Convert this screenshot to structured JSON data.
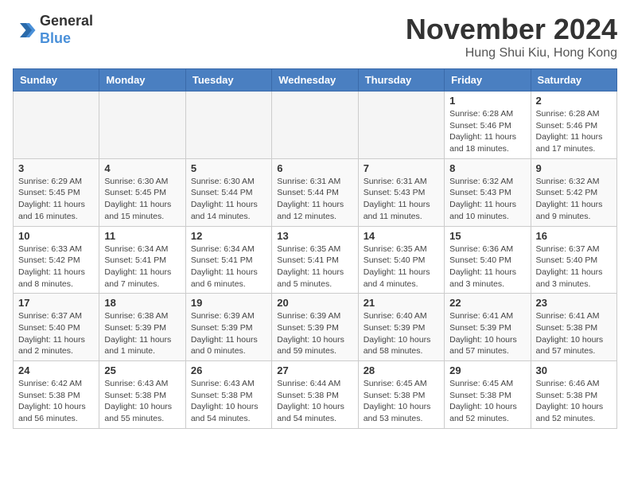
{
  "header": {
    "logo_general": "General",
    "logo_blue": "Blue",
    "month_title": "November 2024",
    "location": "Hung Shui Kiu, Hong Kong"
  },
  "weekdays": [
    "Sunday",
    "Monday",
    "Tuesday",
    "Wednesday",
    "Thursday",
    "Friday",
    "Saturday"
  ],
  "weeks": [
    [
      {
        "day": "",
        "info": ""
      },
      {
        "day": "",
        "info": ""
      },
      {
        "day": "",
        "info": ""
      },
      {
        "day": "",
        "info": ""
      },
      {
        "day": "",
        "info": ""
      },
      {
        "day": "1",
        "info": "Sunrise: 6:28 AM\nSunset: 5:46 PM\nDaylight: 11 hours and 18 minutes."
      },
      {
        "day": "2",
        "info": "Sunrise: 6:28 AM\nSunset: 5:46 PM\nDaylight: 11 hours and 17 minutes."
      }
    ],
    [
      {
        "day": "3",
        "info": "Sunrise: 6:29 AM\nSunset: 5:45 PM\nDaylight: 11 hours and 16 minutes."
      },
      {
        "day": "4",
        "info": "Sunrise: 6:30 AM\nSunset: 5:45 PM\nDaylight: 11 hours and 15 minutes."
      },
      {
        "day": "5",
        "info": "Sunrise: 6:30 AM\nSunset: 5:44 PM\nDaylight: 11 hours and 14 minutes."
      },
      {
        "day": "6",
        "info": "Sunrise: 6:31 AM\nSunset: 5:44 PM\nDaylight: 11 hours and 12 minutes."
      },
      {
        "day": "7",
        "info": "Sunrise: 6:31 AM\nSunset: 5:43 PM\nDaylight: 11 hours and 11 minutes."
      },
      {
        "day": "8",
        "info": "Sunrise: 6:32 AM\nSunset: 5:43 PM\nDaylight: 11 hours and 10 minutes."
      },
      {
        "day": "9",
        "info": "Sunrise: 6:32 AM\nSunset: 5:42 PM\nDaylight: 11 hours and 9 minutes."
      }
    ],
    [
      {
        "day": "10",
        "info": "Sunrise: 6:33 AM\nSunset: 5:42 PM\nDaylight: 11 hours and 8 minutes."
      },
      {
        "day": "11",
        "info": "Sunrise: 6:34 AM\nSunset: 5:41 PM\nDaylight: 11 hours and 7 minutes."
      },
      {
        "day": "12",
        "info": "Sunrise: 6:34 AM\nSunset: 5:41 PM\nDaylight: 11 hours and 6 minutes."
      },
      {
        "day": "13",
        "info": "Sunrise: 6:35 AM\nSunset: 5:41 PM\nDaylight: 11 hours and 5 minutes."
      },
      {
        "day": "14",
        "info": "Sunrise: 6:35 AM\nSunset: 5:40 PM\nDaylight: 11 hours and 4 minutes."
      },
      {
        "day": "15",
        "info": "Sunrise: 6:36 AM\nSunset: 5:40 PM\nDaylight: 11 hours and 3 minutes."
      },
      {
        "day": "16",
        "info": "Sunrise: 6:37 AM\nSunset: 5:40 PM\nDaylight: 11 hours and 3 minutes."
      }
    ],
    [
      {
        "day": "17",
        "info": "Sunrise: 6:37 AM\nSunset: 5:40 PM\nDaylight: 11 hours and 2 minutes."
      },
      {
        "day": "18",
        "info": "Sunrise: 6:38 AM\nSunset: 5:39 PM\nDaylight: 11 hours and 1 minute."
      },
      {
        "day": "19",
        "info": "Sunrise: 6:39 AM\nSunset: 5:39 PM\nDaylight: 11 hours and 0 minutes."
      },
      {
        "day": "20",
        "info": "Sunrise: 6:39 AM\nSunset: 5:39 PM\nDaylight: 10 hours and 59 minutes."
      },
      {
        "day": "21",
        "info": "Sunrise: 6:40 AM\nSunset: 5:39 PM\nDaylight: 10 hours and 58 minutes."
      },
      {
        "day": "22",
        "info": "Sunrise: 6:41 AM\nSunset: 5:39 PM\nDaylight: 10 hours and 57 minutes."
      },
      {
        "day": "23",
        "info": "Sunrise: 6:41 AM\nSunset: 5:38 PM\nDaylight: 10 hours and 57 minutes."
      }
    ],
    [
      {
        "day": "24",
        "info": "Sunrise: 6:42 AM\nSunset: 5:38 PM\nDaylight: 10 hours and 56 minutes."
      },
      {
        "day": "25",
        "info": "Sunrise: 6:43 AM\nSunset: 5:38 PM\nDaylight: 10 hours and 55 minutes."
      },
      {
        "day": "26",
        "info": "Sunrise: 6:43 AM\nSunset: 5:38 PM\nDaylight: 10 hours and 54 minutes."
      },
      {
        "day": "27",
        "info": "Sunrise: 6:44 AM\nSunset: 5:38 PM\nDaylight: 10 hours and 54 minutes."
      },
      {
        "day": "28",
        "info": "Sunrise: 6:45 AM\nSunset: 5:38 PM\nDaylight: 10 hours and 53 minutes."
      },
      {
        "day": "29",
        "info": "Sunrise: 6:45 AM\nSunset: 5:38 PM\nDaylight: 10 hours and 52 minutes."
      },
      {
        "day": "30",
        "info": "Sunrise: 6:46 AM\nSunset: 5:38 PM\nDaylight: 10 hours and 52 minutes."
      }
    ]
  ]
}
